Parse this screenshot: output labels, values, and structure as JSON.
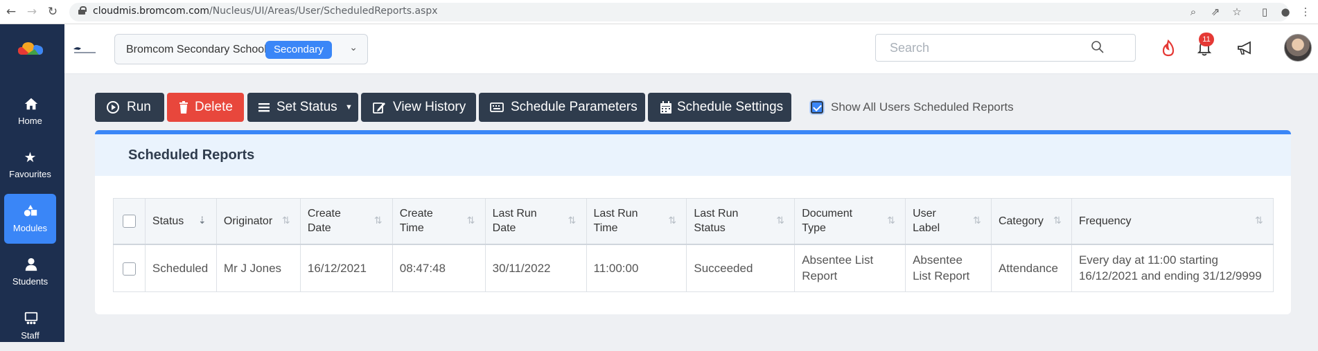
{
  "browser": {
    "url_host": "cloudmis.bromcom.com",
    "url_path": "/Nucleus/UI/Areas/User/ScheduledReports.aspx"
  },
  "sidebar": {
    "items": [
      {
        "label": "Home",
        "icon": "home-icon"
      },
      {
        "label": "Favourites",
        "icon": "star-icon"
      },
      {
        "label": "Modules",
        "icon": "modules-icon"
      },
      {
        "label": "Students",
        "icon": "user-icon"
      },
      {
        "label": "Staff",
        "icon": "staff-icon"
      }
    ],
    "active_index": 2
  },
  "header": {
    "school_name": "Bromcom Secondary School",
    "school_type": "Secondary",
    "search_placeholder": "Search",
    "notification_count": "11"
  },
  "toolbar": {
    "run": "Run",
    "delete": "Delete",
    "set_status": "Set Status",
    "view_history": "View History",
    "schedule_parameters": "Schedule Parameters",
    "schedule_settings": "Schedule Settings",
    "show_all_label": "Show All Users Scheduled Reports",
    "show_all_checked": true
  },
  "panel": {
    "title": "Scheduled Reports"
  },
  "table": {
    "headers": [
      [
        "Status"
      ],
      [
        "Originator"
      ],
      [
        "Create",
        "Date"
      ],
      [
        "Create",
        "Time"
      ],
      [
        "Last Run",
        "Date"
      ],
      [
        "Last Run",
        "Time"
      ],
      [
        "Last Run",
        "Status"
      ],
      [
        "Document",
        "Type"
      ],
      [
        "User",
        "Label"
      ],
      [
        "Category"
      ],
      [
        "Frequency"
      ]
    ],
    "rows": [
      {
        "status": "Scheduled",
        "originator": "Mr J Jones",
        "create_date": "16/12/2021",
        "create_time": "08:47:48",
        "last_run_date": "30/11/2022",
        "last_run_time": "11:00:00",
        "last_run_status": "Succeeded",
        "document_type": [
          "Absentee List",
          "Report"
        ],
        "user_label": [
          "Absentee",
          "List Report"
        ],
        "category": "Attendance",
        "frequency": [
          "Every day at 11:00 starting",
          "16/12/2021 and ending 31/12/9999"
        ]
      }
    ]
  },
  "colors": {
    "sidebar": "#1d2f4f",
    "accent": "#3a86f7",
    "button_dark": "#2f3c4d",
    "button_danger": "#e8473c"
  }
}
